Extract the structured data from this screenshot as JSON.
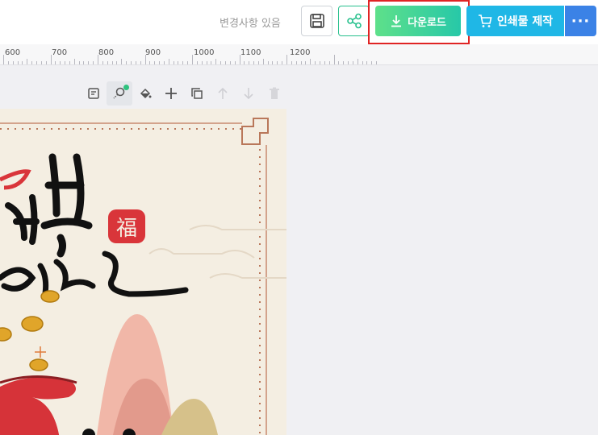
{
  "header": {
    "status_text": "변경사항 있음",
    "download_label": "다운로드",
    "print_label": "인쇄물 제작",
    "more_label": "···"
  },
  "ruler": {
    "labels": [
      "600",
      "700",
      "800",
      "900",
      "1000",
      "1100",
      "1200"
    ]
  },
  "toolbar": {
    "tools": [
      "note-icon",
      "magic-wand-icon",
      "fill-bucket-icon",
      "plus-icon",
      "duplicate-icon",
      "arrow-up-icon",
      "arrow-down-icon",
      "trash-icon"
    ]
  },
  "canvas": {
    "stamp_text": "福"
  },
  "colors": {
    "download_start": "#5ee08a",
    "download_end": "#27c8a8",
    "print": "#1fb7e6",
    "more": "#3b82e6",
    "highlight": "#e02424",
    "share": "#27c08d"
  }
}
